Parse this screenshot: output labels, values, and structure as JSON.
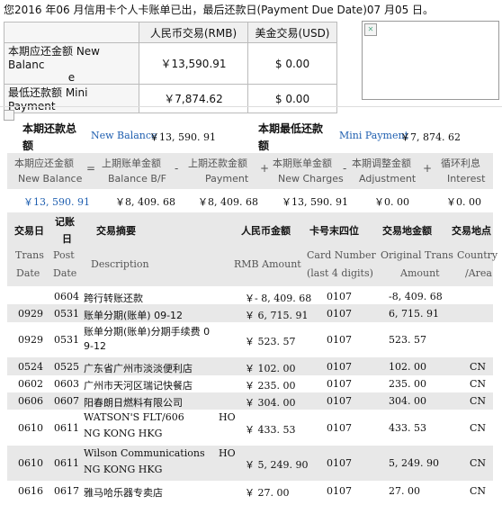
{
  "notice": "您2016 年06 月信用卡个人卡账单已出，最后还款日(Payment Due Date)07 月05 日。",
  "summary_table": {
    "header": [
      "人民币交易(RMB)",
      "美金交易(USD)"
    ],
    "rows": [
      {
        "label_line1": "本期应还金额 New Balanc",
        "label_line2": "e",
        "rmb": "￥13,590.91",
        "usd": "$ 0.00"
      },
      {
        "label": "最低还款额 Mini Payment",
        "rmb": "￥7,874.62",
        "usd": "$ 0.00"
      }
    ]
  },
  "balance_block": {
    "new_balance_label_cn_1": "本期还款总",
    "new_balance_label_cn_2": "额",
    "new_balance_label_en": "New Balance",
    "new_balance_value": "￥13, 590. 91",
    "min_label_cn_1": "本期最低还款",
    "min_label_cn_2": "额",
    "min_label_en": "Mini Payment",
    "min_value": "￥7, 874. 62"
  },
  "formula": {
    "items": [
      {
        "cn": "本期应还金额",
        "en": "New Balance",
        "value": "￥13, 590. 91"
      },
      {
        "cn": "上期账单金额",
        "en": "Balance B/F",
        "value": "￥8, 409. 68"
      },
      {
        "cn": "上期还款金额",
        "en": "Payment",
        "value": "￥8, 409. 68"
      },
      {
        "cn": "本期账单金额",
        "en": "New Charges",
        "value": "￥13, 590. 91"
      },
      {
        "cn": "本期调整金额",
        "en": "Adjustment",
        "value": "￥0. 00"
      },
      {
        "cn": "循环利息",
        "en": "Interest",
        "value": "￥0. 00"
      }
    ],
    "ops": [
      "=",
      "-",
      "+",
      "-",
      "+"
    ]
  },
  "transactions": {
    "headers_cn": [
      "交易日",
      "记账",
      "日",
      "交易摘要",
      "人民币金额",
      "卡号末四位",
      "交易地金额",
      "交易地点"
    ],
    "headers_en": [
      "Trans",
      "Date",
      "Post",
      "Date",
      "Description",
      "RMB Amount",
      "Card Number",
      "(last 4 digits)",
      "Original Trans",
      "Amount",
      "Country",
      "/Area"
    ],
    "rows": [
      {
        "trans": "",
        "post": "0604",
        "desc1": "跨行转账还款",
        "desc2": "",
        "desc_tail1": "",
        "desc_tail2": "",
        "rmb": "￥- 8, 409. 68",
        "card": "0107",
        "orig": "-8, 409. 68",
        "area": ""
      },
      {
        "trans": "0929",
        "post": "0531",
        "desc1": "账单分期(账单) 09-12",
        "desc2": "",
        "desc_tail1": "",
        "desc_tail2": "",
        "rmb": "￥ 6, 715. 91",
        "card": "0107",
        "orig": "6, 715. 91",
        "area": ""
      },
      {
        "trans": "0929",
        "post": "0531",
        "desc1": "账单分期(账单)分期手续费 0",
        "desc2": "9-12",
        "desc_tail1": "",
        "desc_tail2": "",
        "rmb": "￥ 523. 57",
        "card": "0107",
        "orig": "523. 57",
        "area": ""
      },
      {
        "trans": "0524",
        "post": "0525",
        "desc1": "广东省广州市淡淡便利店",
        "desc2": "",
        "desc_tail1": "",
        "desc_tail2": "",
        "rmb": "￥ 102. 00",
        "card": "0107",
        "orig": "102. 00",
        "area": "CN"
      },
      {
        "trans": "0602",
        "post": "0603",
        "desc1": "广州市天河区瑞记快餐店",
        "desc2": "",
        "desc_tail1": "",
        "desc_tail2": "",
        "rmb": "￥ 235. 00",
        "card": "0107",
        "orig": "235. 00",
        "area": "CN"
      },
      {
        "trans": "0606",
        "post": "0607",
        "desc1": "阳春朗日燃料有限公司",
        "desc2": "",
        "desc_tail1": "",
        "desc_tail2": "",
        "rmb": "￥ 304. 00",
        "card": "0107",
        "orig": "304. 00",
        "area": "CN"
      },
      {
        "trans": "0610",
        "post": "0611",
        "desc1": "WATSON'S FLT/606",
        "desc2": "NG KONG   HKG",
        "desc_tail1": "HO",
        "desc_tail2": "",
        "rmb": "￥ 433. 53",
        "card": "0107",
        "orig": "433. 53",
        "area": "CN"
      },
      {
        "trans": "0610",
        "post": "0611",
        "desc1": "Wilson Communications",
        "desc2": "NG KONG   HKG",
        "desc_tail1": "HO",
        "desc_tail2": "",
        "rmb": "￥ 5, 249. 90",
        "card": "0107",
        "orig": "5, 249. 90",
        "area": "CN"
      },
      {
        "trans": "0616",
        "post": "0617",
        "desc1": "雅马哈乐器专卖店",
        "desc2": "",
        "desc_tail1": "",
        "desc_tail2": "",
        "rmb": "￥ 27. 00",
        "card": "0107",
        "orig": "27. 00",
        "area": "CN"
      }
    ]
  }
}
